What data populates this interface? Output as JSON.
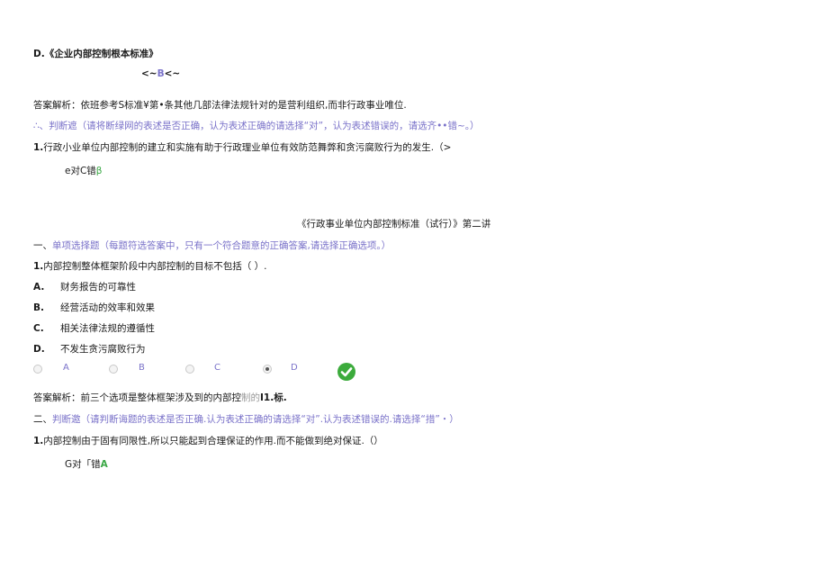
{
  "block1": {
    "option_d": "D.《企业内部控制根本标准》",
    "answer_mark_pre": "<~",
    "answer_mark_letter": "B",
    "answer_mark_post": "<~",
    "analysis": "答案解析：依班参考S标准¥第•条其他几部法律法规针对的是营利组织,而非行政事业唯位.",
    "section_prefix": "∴、",
    "section_title": "判断遮（请将断绿网的表述是否正确，认为表述正确的请选择“对”，认为表述错误的，请选齐••错~。）",
    "q1_num": "1.",
    "q1_text": "行政小业单位内部控制的建立和实施有助于行政理业单位有效防范舞弊和贪污腐败行为的发生.（>",
    "answer_a": "e对C错",
    "answer_b": "β"
  },
  "block2": {
    "heading": "《行政事业单位内部控制标准（试行）》第二讲",
    "section1_prefix": "一、",
    "section1_title": "单项选择题（每题符选答案中，只有一个符合题意的正确答案,请选择正确选项。）",
    "q1_num": "1.",
    "q1_text": "内部控制整体框架阶段中内部控制的目标不包括（ ）.",
    "options": [
      {
        "letter": "A.",
        "text": "财务报告的可靠性"
      },
      {
        "letter": "B.",
        "text": "经营活动的效率和效果"
      },
      {
        "letter": "C.",
        "text": "相关法律法规的遵循性"
      },
      {
        "letter": "D.",
        "text": "不发生贪污腐败行为"
      }
    ],
    "radio_labels": [
      "A",
      "B",
      "C",
      "D"
    ],
    "selected": "D",
    "analysis_pre": "答案解析：前三个选项是整体框架涉及到的内部控",
    "analysis_mid": "制的",
    "analysis_post": "I1.标.",
    "section2_prefix": "二、",
    "section2_title": "判断邀（请判断诲题的表述是否正确.认为表述正确的请选择“对”.认为表述错误的.请选择“措”・）",
    "q2_num": "1.",
    "q2_text": "内部控制由于固有同限性,所以只能起到合理保证的作用.而不能做到绝对保证.（）",
    "answer2_a": "G对「错",
    "answer2_b": "A"
  },
  "colors": {
    "accent": "#7a72c9",
    "correct": "#3aa845"
  }
}
